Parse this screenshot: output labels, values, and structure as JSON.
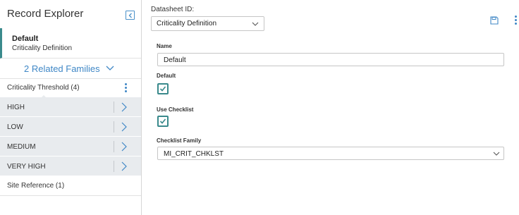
{
  "record_explorer": {
    "title": "Record Explorer",
    "selected_record": {
      "name": "Default",
      "family": "Criticality Definition"
    },
    "related_families_label": "2 Related Families",
    "families": [
      {
        "label": "Criticality Threshold (4)",
        "records": [
          "HIGH",
          "LOW",
          "MEDIUM",
          "VERY HIGH"
        ]
      },
      {
        "label": "Site Reference (1)",
        "records": []
      }
    ]
  },
  "datasheet": {
    "label": "Datasheet ID:",
    "selected": "Criticality Definition"
  },
  "form": {
    "name": {
      "label": "Name",
      "value": "Default"
    },
    "default": {
      "label": "Default",
      "checked": true
    },
    "use_checklist": {
      "label": "Use Checklist",
      "checked": true
    },
    "checklist_family": {
      "label": "Checklist Family",
      "value": "MI_CRIT_CHKLST"
    }
  },
  "colors": {
    "accent_blue": "#3f87c6",
    "accent_teal": "#3a8a8c",
    "list_bg": "#e8ebee"
  },
  "icons": {
    "collapse": "collapse-panel-icon",
    "save": "save-icon",
    "more": "kebab-menu-icon",
    "chevron": "chevron-icon"
  }
}
